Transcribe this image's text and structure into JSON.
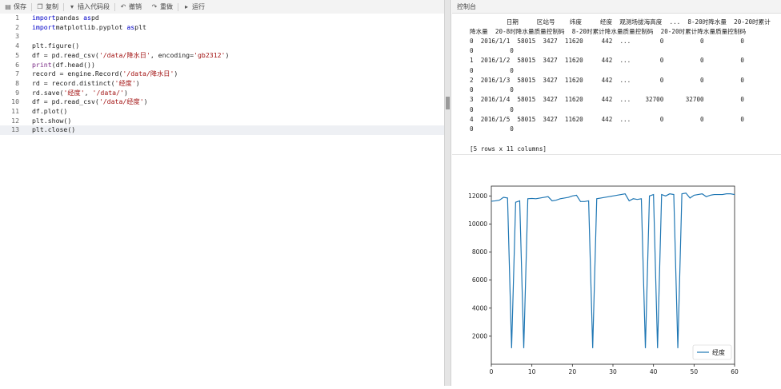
{
  "toolbar": {
    "save": "保存",
    "copy": "复制",
    "insert": "插入代码段",
    "undo": "撤销",
    "redo": "重做",
    "run": "运行"
  },
  "editor": {
    "lines": [
      {
        "n": "1",
        "parts": [
          [
            "kw",
            "import"
          ],
          [
            "",
            "pandas "
          ],
          [
            "kw",
            "as"
          ],
          [
            "",
            "pd"
          ]
        ]
      },
      {
        "n": "2",
        "parts": [
          [
            "kw",
            "import"
          ],
          [
            "",
            "matplotlib.pyplot "
          ],
          [
            "kw",
            "as"
          ],
          [
            "",
            "plt"
          ]
        ]
      },
      {
        "n": "3",
        "parts": []
      },
      {
        "n": "4",
        "parts": [
          [
            "",
            "plt.figure()"
          ]
        ]
      },
      {
        "n": "5",
        "parts": [
          [
            "",
            "df = pd.read_csv("
          ],
          [
            "str",
            "'/data/降水日'"
          ],
          [
            "",
            ", encoding="
          ],
          [
            "str",
            "'gb2312'"
          ],
          [
            "",
            ")"
          ]
        ]
      },
      {
        "n": "6",
        "parts": [
          [
            "fn",
            "print"
          ],
          [
            "",
            "(df.head())"
          ]
        ]
      },
      {
        "n": "7",
        "parts": [
          [
            "",
            "record = engine.Record("
          ],
          [
            "str",
            "'/data/降水日'"
          ],
          [
            "",
            ")"
          ]
        ]
      },
      {
        "n": "8",
        "parts": [
          [
            "",
            "rd = record.distinct("
          ],
          [
            "str",
            "'经度'"
          ],
          [
            "",
            ")"
          ]
        ]
      },
      {
        "n": "9",
        "parts": [
          [
            "",
            "rd.save("
          ],
          [
            "str",
            "'经度'"
          ],
          [
            "",
            ", "
          ],
          [
            "str",
            "'/data/'"
          ],
          [
            "",
            ")"
          ]
        ]
      },
      {
        "n": "10",
        "parts": [
          [
            "",
            "df = pd.read_csv("
          ],
          [
            "str",
            "'/data/经度'"
          ],
          [
            "",
            ")"
          ]
        ]
      },
      {
        "n": "11",
        "parts": [
          [
            "",
            "df.plot()"
          ]
        ]
      },
      {
        "n": "12",
        "parts": [
          [
            "",
            "plt.show()"
          ]
        ]
      },
      {
        "n": "13",
        "parts": [
          [
            "",
            "plt.close()"
          ]
        ]
      }
    ]
  },
  "console": {
    "title": "控制台",
    "lines": [
      "          日期     区站号    纬度     经度  观测场拔海高度  ...  8-20时降水量  20-20时累计",
      "降水量  20-8时降水量质量控制码  8-20时累计降水量质量控制码  20-20时累计降水量质量控制码",
      "0  2016/1/1  58015  3427  11620     442  ...        0          0          0",
      "0          0",
      "1  2016/1/2  58015  3427  11620     442  ...        0          0          0",
      "0          0",
      "2  2016/1/3  58015  3427  11620     442  ...        0          0          0",
      "0          0",
      "3  2016/1/4  58015  3427  11620     442  ...    32700      32700          0",
      "0          0",
      "4  2016/1/5  58015  3427  11620     442  ...        0          0          0",
      "0          0",
      "",
      "[5 rows x 11 columns]"
    ]
  },
  "chart_data": {
    "type": "line",
    "xlim": [
      0,
      60
    ],
    "ylim": [
      0,
      12700
    ],
    "xticks": [
      0,
      10,
      20,
      30,
      40,
      50,
      60
    ],
    "yticks": [
      2000,
      4000,
      6000,
      8000,
      10000,
      12000
    ],
    "legend_position": "bottom-right",
    "series": [
      {
        "name": "经度",
        "color": "#1f77b4",
        "x": [
          0,
          1,
          2,
          3,
          4,
          5,
          6,
          7,
          8,
          9,
          10,
          11,
          12,
          13,
          14,
          15,
          16,
          17,
          18,
          19,
          20,
          21,
          22,
          23,
          24,
          25,
          26,
          27,
          28,
          29,
          30,
          31,
          32,
          33,
          34,
          35,
          36,
          37,
          38,
          39,
          40,
          41,
          42,
          43,
          44,
          45,
          46,
          47,
          48,
          49,
          50,
          51,
          52,
          53,
          54,
          55,
          56,
          57,
          58,
          59,
          60
        ],
        "values": [
          11620,
          11650,
          11700,
          11900,
          11850,
          1150,
          11550,
          11650,
          1150,
          11800,
          11820,
          11800,
          11850,
          11900,
          11950,
          11650,
          11700,
          11800,
          11850,
          11900,
          12000,
          12050,
          11600,
          11600,
          11650,
          1150,
          11800,
          11850,
          11900,
          11950,
          12000,
          12050,
          12100,
          12150,
          11650,
          11800,
          11750,
          11800,
          1150,
          12000,
          12100,
          1150,
          12100,
          12000,
          12150,
          12100,
          1150,
          12150,
          12200,
          11850,
          12050,
          12100,
          12150,
          11950,
          12050,
          12100,
          12100,
          12100,
          12150,
          12150,
          12100
        ]
      }
    ]
  }
}
